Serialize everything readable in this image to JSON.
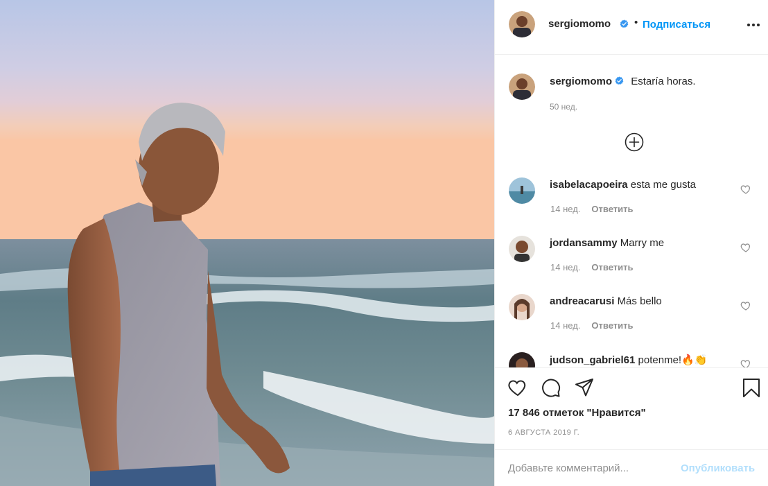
{
  "post": {
    "author": "sergiomomo",
    "follow_label": "Подписаться",
    "separator": "•",
    "caption_text": "Estaría horas.",
    "caption_time": "50 нед.",
    "likes_label": "17 846 отметок \"Нравится\"",
    "date_label": "6 АВГУСТА 2019 Г."
  },
  "comments": [
    {
      "user": "isabelacapoeira",
      "text": "esta me gusta",
      "time": "14 нед.",
      "reply": "Ответить"
    },
    {
      "user": "jordansammy",
      "text": "Marry me",
      "time": "14 нед.",
      "reply": "Ответить"
    },
    {
      "user": "andreacarusi",
      "text": "Más bello",
      "time": "14 нед.",
      "reply": "Ответить"
    },
    {
      "user": "judson_gabriel61",
      "text": "potenme!🔥👏",
      "time": "",
      "reply": ""
    }
  ],
  "composer": {
    "placeholder": "Добавьте комментарий...",
    "publish_label": "Опубликовать"
  },
  "icons": {
    "header": [
      "verified-badge",
      "more-options-icon"
    ],
    "actions": [
      "heart-icon",
      "comment-icon",
      "share-icon",
      "bookmark-icon"
    ],
    "load_more": "plus-circle-icon"
  },
  "colors": {
    "accent": "#0095f6",
    "verified": "#3897f0",
    "publish_disabled": "#b2dffc",
    "muted": "#8e8e8e"
  }
}
